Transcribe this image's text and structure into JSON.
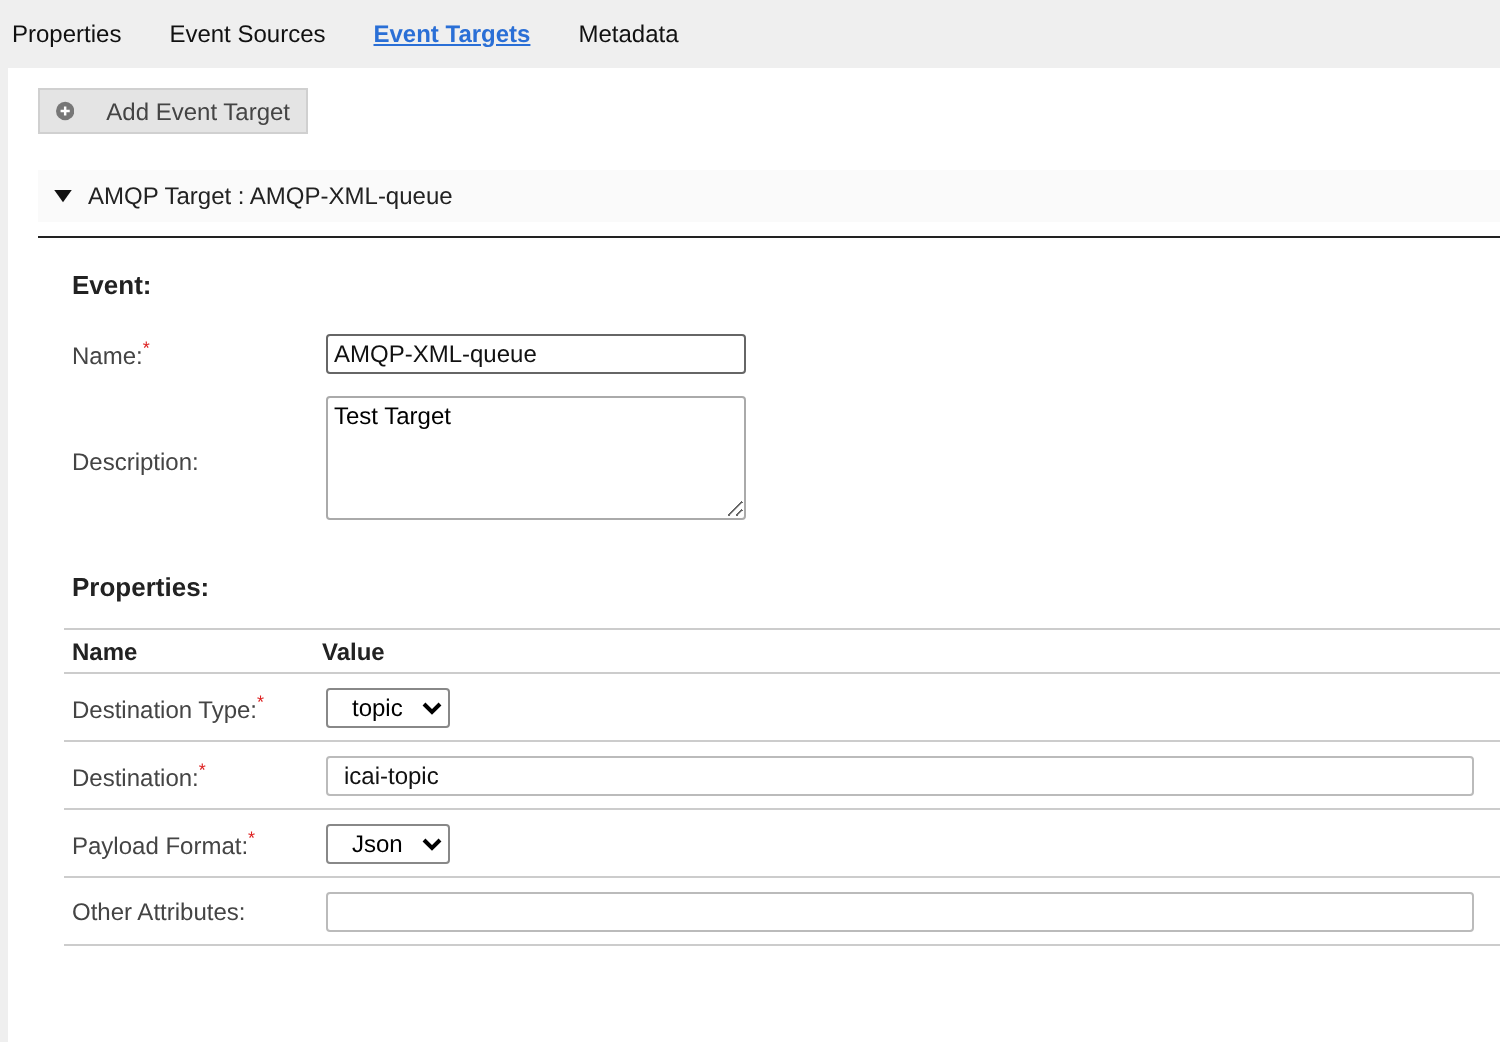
{
  "tabs": [
    {
      "label": "Properties",
      "selected": false
    },
    {
      "label": "Event Sources",
      "selected": false
    },
    {
      "label": "Event Targets",
      "selected": true
    },
    {
      "label": "Metadata",
      "selected": false
    }
  ],
  "add_button": {
    "label": "Add Event Target"
  },
  "target": {
    "title": "AMQP Target : AMQP-XML-queue",
    "expanded": true
  },
  "event": {
    "heading": "Event:",
    "name": {
      "label": "Name:$^{*}$",
      "value": "AMQP-XML-queue"
    },
    "description": {
      "label": "Description:",
      "value": "Test Target"
    }
  },
  "properties": {
    "heading": "Properties:",
    "columns": [
      "Name",
      "Value"
    ],
    "rows": [
      {
        "label": "Destination Type:$^{*}$",
        "kind": "select",
        "value": "topic"
      },
      {
        "label": "Destination:$^{*}$",
        "kind": "text",
        "value": "icai-topic"
      },
      {
        "label": "Payload Format:$^{*}$",
        "kind": "select",
        "value": "Json"
      },
      {
        "label": "Other Attributes:",
        "kind": "text"
      }
    ]
  }
}
